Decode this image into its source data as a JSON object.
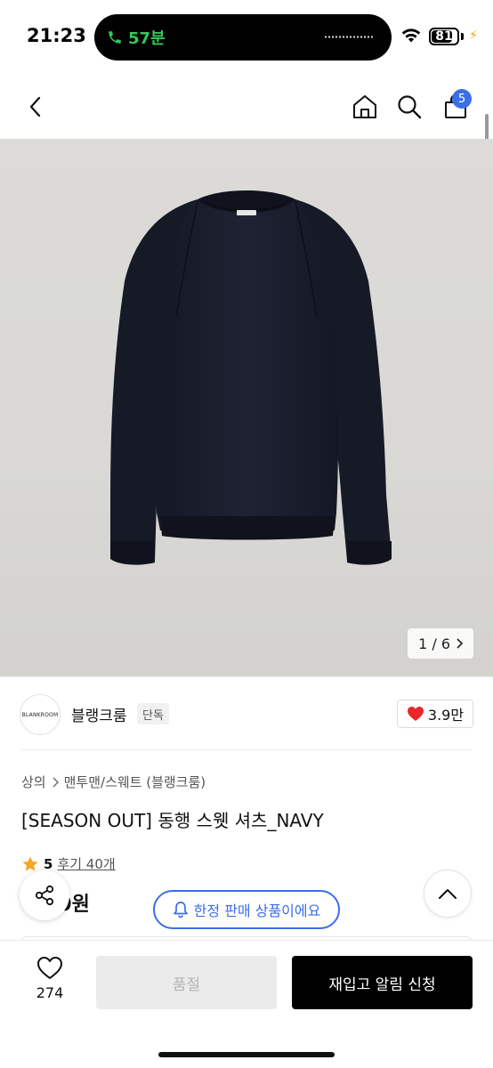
{
  "status_bar": {
    "time": "21:23",
    "call_duration": "57분",
    "battery_level": "81"
  },
  "nav": {
    "cart_count": "5"
  },
  "product": {
    "image_counter": "1 / 6",
    "brand_logo_text": "BLANKROOM",
    "brand_name": "블랭크룸",
    "exclusive_badge": "단독",
    "like_count": "3.9만",
    "category_main": "상의",
    "category_sub": "맨투맨/스웨트 (블랭크룸)",
    "title": "[SEASON OUT] 동행 스웻 셔츠_NAVY",
    "rating": "5",
    "review_link": "후기 40개",
    "price": "00원"
  },
  "floating": {
    "limited_banner": "한정 판매 상품이에요"
  },
  "bottom_bar": {
    "wishlist_count": "274",
    "soldout_label": "품절",
    "restock_label": "재입고 알림 신청"
  },
  "colors": {
    "accent_blue": "#3b6ee8",
    "heart_red": "#e8262c",
    "star_gold": "#f5a623",
    "call_green": "#34c759",
    "garment_navy": "#1b1f2d"
  }
}
